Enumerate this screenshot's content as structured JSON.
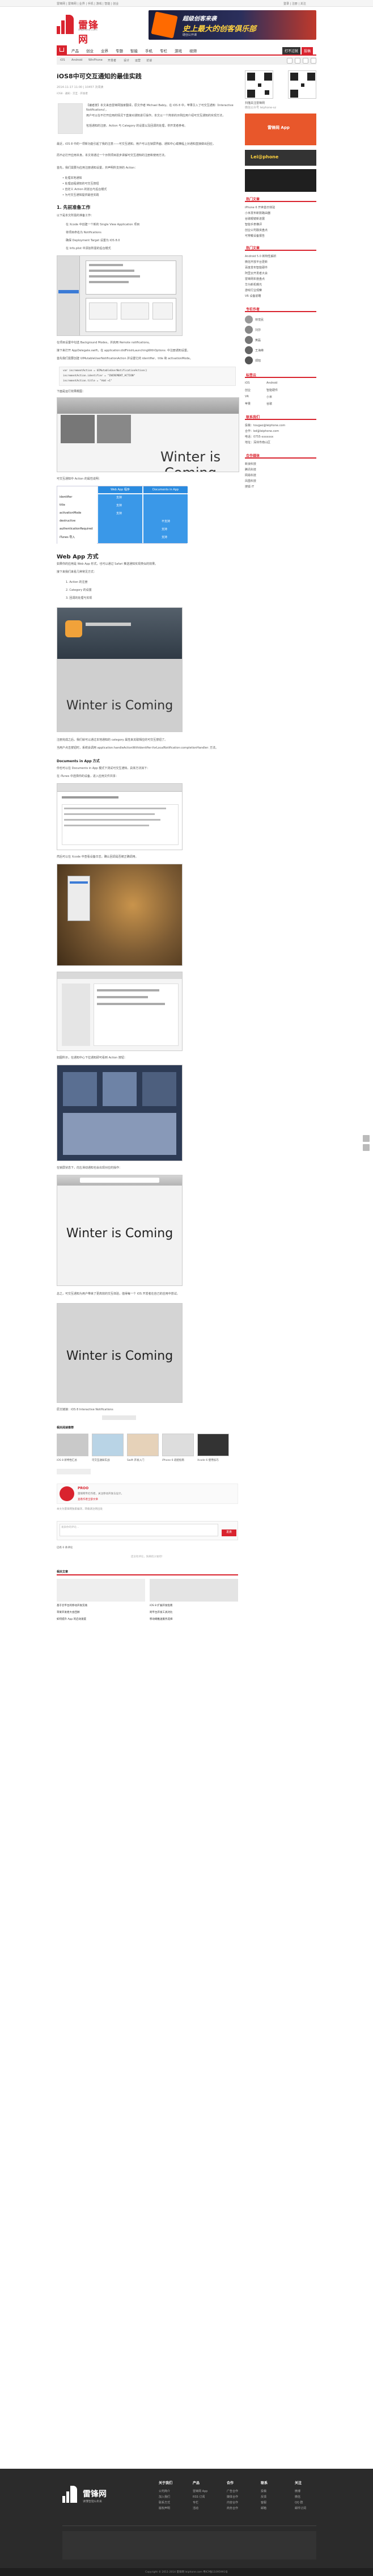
{
  "topbar": {
    "left": "雷锋网 | 雷锋网 | 业界 | 手机 | 游戏 | 智能 | 创业",
    "right": "登录 | 注册 | 关注"
  },
  "brand": {
    "name": "雷锋网",
    "tagline": "leiphone.com",
    "ad_line1": "超级创客来袭",
    "ad_line2": "史上最大的创客俱乐部",
    "ad_line3": "硬创公开课"
  },
  "nav": {
    "items": [
      "产品",
      "创业",
      "业界",
      "专题",
      "智能",
      "手机",
      "专栏",
      "游戏",
      "视频"
    ],
    "right1": "打不过就",
    "right2": "投稿",
    "sub_items": [
      "iOS",
      "Android",
      "WinPhone",
      "开发者",
      "设计",
      "运营",
      "访谈"
    ]
  },
  "article": {
    "title": "iOS8中可交互通知的最佳实践",
    "meta": "2014-11-17 11:00 | 10457 次阅读",
    "tags": "iOS8 · 通知 · 交互 · 开发者",
    "summary_1": "【编者按】本文来自雷锋网独家翻译，原文作者 Michael Babiy。在 iOS 8 中，苹果引入了可交互通知（Interactive Notifications），",
    "summary_2": "用户可以在不打开应用的情况下直接对通知进行操作。本文以一个简单的示例应用介绍可交互通知的实现方法，",
    "summary_3": "包括通知的注册、Action 与 Category 的设置以及回调的处理，供开发者参考。",
    "p1": "最近，iOS 8 中的一项新功能引起了我的注意——可交互通知。用户可以在锁屏界面、通知中心或横幅上对通知直接做出回应，",
    "p2": "而不必打开应用本身。本文将通过一个示例项目逐步讲解可交互通知的注册和使用方法。",
    "p3": "首先，我们需要为应用注册通知设置，并声明所支持的 Action：",
    "list1": [
      "• 处理本地通知",
      "• 处理远程通知的可交互按钮",
      "• 自定义 Action 的前台与后台模式",
      "• 为可交互通知提供最佳实践"
    ],
    "h_prepare": "1. 先前准备工作",
    "prep_text": "以下是本文所需的准备工作：",
    "prep_list": [
      "在 Xcode 中创建一个新的 Single View Application 项目",
      "将项目命名为 Notifications",
      "确保 Deployment Target 设置为 iOS 8.0",
      "在 Info.plist 中添加所需的后台模式"
    ],
    "after_shot1": "在项目设置中勾选 Background Modes，并启用 Remote notifications。",
    "after_shot1_b": "接下来打开 AppDelegate.swift，在 application:didFinishLaunchingWithOptions: 中注册通知设置。",
    "after_shot1_c": "首先我们需要创建 UIMutableUserNotificationAction 并设置它的 identifier、title 和 activationMode。",
    "code1": [
      "var incrementAction = UIMutableUserNotificationAction()",
      "incrementAction.identifier = \"INCREMENT_ACTION\"",
      "incrementAction.title = \"Add +1\""
    ],
    "after_code1": "下面是运行效果截图：",
    "winter_1": "Winter is Coming",
    "caption_table": "可交互通知中 Action 的属性说明：",
    "table_left": [
      "identifier",
      "title",
      "activationMode",
      "destructive",
      "authenticationRequired",
      "iTunes 导入"
    ],
    "table_head1": "Web App 程序",
    "table_head2": "Documents in App",
    "table_cells": [
      "支持",
      "支持",
      "支持",
      "不支持",
      "支持",
      "支持"
    ],
    "h_webapp": "Web App 方式",
    "webapp_text": "如果你的应用是 Web App 形式，也可以通过 Safari 推送通知实现类似的效果。",
    "webapp_text2": "接下来我们来看几种常见方式：",
    "steps": [
      "1. Action 的注册",
      "2. Category 的设置",
      "3. 回调的处理与实现"
    ],
    "winter_2": "Winter is Coming",
    "after_winter2": "注册完成之后，我们就可以通过本地通知的 category 属性来关联相应的可交互按钮了。",
    "after_winter2_b": "当用户点击按钮时，系统会调用 application:handleActionWithIdentifier:forLocalNotification:completionHandler: 方法。",
    "h_docs": "Documents in App 方式",
    "docs_text": "你也可以在 Documents in App 模式下测试可交互通知，具体方法如下：",
    "docs_text2": "在 iTunes 中选择你的设备，进入应用文件共享：",
    "after_shot3": "然后可以在 Xcode 中查看设备日志，确认回调是否被正确调用。",
    "after_shot4": "如图所示，在通知中心下拉通知即可看到 Action 按钮：",
    "after_shot5": "在锁屏状态下，向左滑动通知也会出现对应的操作：",
    "winter_3": "Winter is Coming",
    "winter_4": "Winter is Coming",
    "after_winter4": "总之，可交互通知为用户带来了更高效的交互体验，值得每一个 iOS 开发者在自己的应用中尝试。",
    "source": "原文链接：iOS 8 Interactive Notifications",
    "related_head": "相关阅读推荐",
    "related": [
      "iOS 8 新特性汇总",
      "可交互通知实战",
      "Swift 开发入门",
      "iPhone 6 适配指南",
      "Xcode 6 使用技巧"
    ],
    "author_name": "PROO",
    "author_desc": "雷锋网专栏作者，关注移动开发与设计。",
    "author_link": "查看作者全部文章",
    "source_line": "本文为雷锋网独家编译，转载请注明出处",
    "comment_placeholder": "发表你的评论…",
    "comment_btn": "发表",
    "comment_count": "已有 0 条评论",
    "comment_empty": "还没有评论，快来抢沙发吧！",
    "more_head": "相关文章",
    "more": [
      "基于云平台的移动开发实践",
      "iOS 8 扩展开发指南",
      "苹果开发者大会回顾",
      "跨平台开发工具对比",
      "如何提升 App 的启动速度",
      "移动端推送服务选择"
    ]
  },
  "sidebar": {
    "qr_title": "扫描关注雷锋网",
    "qr_caption": "微信公众号 leiphone-sz",
    "app_ad": "雷锋网 App",
    "banner_text": "Lei@phone",
    "head_hot": "热门文章",
    "hot": [
      "iPhone 6 开卖首日体验",
      "小米发布新款路由器",
      "谷歌眼镜新进展",
      "智能手表横评",
      "创业公司融资盘点",
      "可穿戴设备报告"
    ],
    "head_recent": "热门文章",
    "recent": [
      "Android 5.0 新特性解析",
      "微信开放平台更新",
      "百度发布智能硬件",
      "阿里云开发者大会",
      "雷锋网年度盘点",
      "华为新机曝光",
      "游戏行业观察",
      "VR 设备前瞻"
    ],
    "head_col": "专栏作者",
    "col": [
      "林觉民",
      "刘莎",
      "黄磊",
      "王海峰",
      "郑旭"
    ],
    "head_tags": "标签云",
    "tags": [
      "iOS",
      "Android",
      "创业",
      "智能硬件",
      "VR",
      "小米",
      "苹果",
      "谷歌"
    ],
    "head_contact": "联系我们",
    "contact": [
      "投稿：tougao@leiphone.com",
      "合作：bd@leiphone.com",
      "电话：0755-xxxxxxx",
      "地址：深圳市南山区"
    ],
    "head_friends": "合作媒体",
    "friends": [
      "新浪科技",
      "腾讯科技",
      "网易科技",
      "凤凰科技",
      "搜狐 IT"
    ]
  },
  "footer": {
    "logo": "雷锋网",
    "slogan": "读懂智能&未来",
    "col_heads": [
      "关于我们",
      "产品",
      "合作",
      "联系",
      "关注"
    ],
    "col_items": [
      [
        "公司简介",
        "加入我们",
        "联系方式",
        "版权声明"
      ],
      [
        "雷锋网 App",
        "RSS 订阅",
        "专栏",
        "活动"
      ],
      [
        "广告合作",
        "媒体合作",
        "内容合作",
        "商务合作"
      ],
      [
        "投稿",
        "反馈",
        "客服",
        "邮箱"
      ],
      [
        "微博",
        "微信",
        "QQ 群",
        "邮件订阅"
      ]
    ],
    "copyright": "Copyright © 2011-2014 雷锋网 leiphone.com 粤ICP备11095991号"
  }
}
